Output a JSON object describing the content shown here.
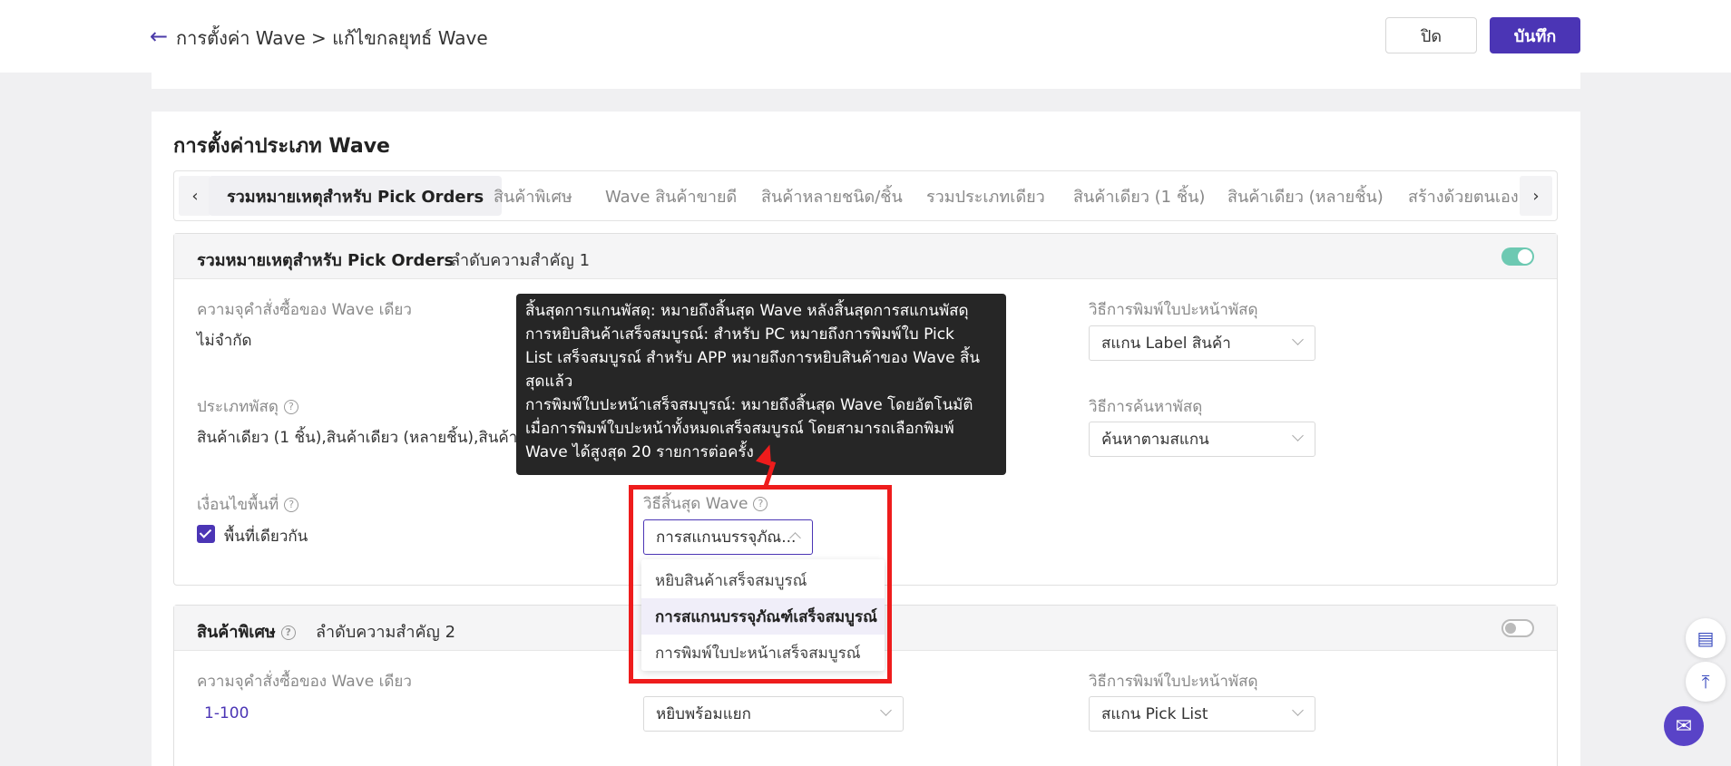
{
  "header": {
    "breadcrumb": "การตั้งค่า Wave > แก้ไขกลยุทธ์ Wave",
    "close_label": "ปิด",
    "save_label": "บันทึก"
  },
  "section_title": "การตั้งค่าประเภท Wave",
  "tabs": [
    {
      "label": "รวมหมายเหตุสำหรับ Pick Orders",
      "active": true
    },
    {
      "label": "สินค้าพิเศษ"
    },
    {
      "label": "Wave สินค้าขายดี"
    },
    {
      "label": "สินค้าหลายชนิด/ชิ้น"
    },
    {
      "label": "รวมประเภทเดียว"
    },
    {
      "label": "สินค้าเดียว (1 ชิ้น)"
    },
    {
      "label": "สินค้าเดียว (หลายชิ้น)"
    },
    {
      "label": "สร้างด้วยตนเอง"
    }
  ],
  "panel1": {
    "title": "รวมหมายเหตุสำหรับ Pick Orders",
    "priority": "ลำดับความสำคัญ 1",
    "enabled": true,
    "capacity_label": "ความจุคำสั่งซื้อของ Wave เดียว",
    "capacity_value": "ไม่จำกัด",
    "print_method_label": "วิธีการพิมพ์ใบปะหน้าพัสดุ",
    "print_method_value": "สแกน Label สินค้า",
    "parcel_type_label": "ประเภทพัสดุ",
    "parcel_type_value": "สินค้าเดียว (1 ชิ้น),สินค้าเดียว (หลายชิ้น),สินค้าหล",
    "search_method_label": "วิธีการค้นหาพัสดุ",
    "search_method_value": "ค้นหาตามสแกน",
    "area_condition_label": "เงื่อนไขพื้นที่",
    "same_area_label": "พื้นที่เดียวกัน",
    "same_area_checked": true,
    "wave_end_label": "วิธีสิ้นสุด Wave",
    "wave_end_value": "การสแกนบรรจุภัณ..."
  },
  "wave_end_options": [
    "หยิบสินค้าเสร็จสมบูรณ์",
    "การสแกนบรรจุภัณฑ์เสร็จสมบูรณ์",
    "การพิมพ์ใบปะหน้าเสร็จสมบูรณ์"
  ],
  "tooltip_lines": [
    "สิ้นสุดการแกนพัสดุ: หมายถึงสิ้นสุด Wave หลังสิ้นสุดการสแกนพัสดุ",
    "การหยิบสินค้าเสร็จสมบูรณ์: สำหรับ PC หมายถึงการพิมพ์ใบ Pick",
    "List เสร็จสมบูรณ์ สำหรับ APP หมายถึงการหยิบสินค้าของ Wave สิ้น",
    "สุดแล้ว",
    "การพิมพ์ใบปะหน้าเสร็จสมบูรณ์: หมายถึงสิ้นสุด Wave โดยอัตโนมัติ",
    "เมื่อการพิมพ์ใบปะหน้าทั้งหมดเสร็จสมบูรณ์ โดยสามารถเลือกพิมพ์",
    "Wave ได้สูงสุด 20 รายการต่อครั้ง"
  ],
  "panel2": {
    "title": "สินค้าพิเศษ",
    "priority": "ลำดับความสำคัญ 2",
    "enabled": false,
    "capacity_label": "ความจุคำสั่งซื้อของ Wave เดียว",
    "capacity_value": "1-100",
    "pick_method_value": "หยิบพร้อมแยก",
    "print_method_label": "วิธีการพิมพ์ใบปะหน้าพัสดุ",
    "print_method_value": "สแกน Pick List"
  },
  "colors": {
    "brand": "#4b35b5",
    "toggle_on": "#6dc9b2",
    "annotation": "#ee1c1c"
  },
  "icons": {
    "back": "arrow-left",
    "help": "question-circle",
    "tab_prev": "chevron-left",
    "tab_next": "chevron-right",
    "feedback": "bookmark-list",
    "to_top": "arrow-to-top",
    "chat": "chat-bubble"
  }
}
